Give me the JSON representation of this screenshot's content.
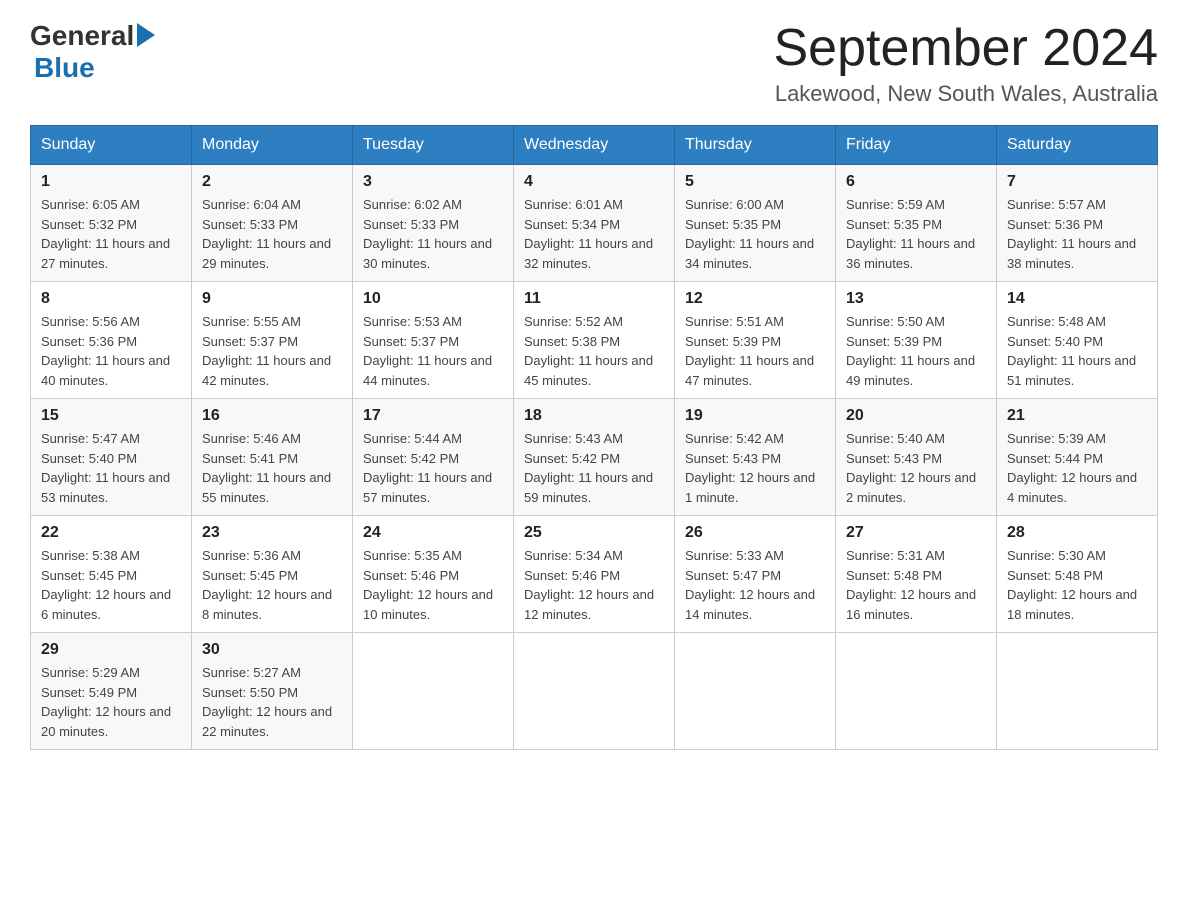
{
  "header": {
    "logo_general": "General",
    "logo_blue": "Blue",
    "title": "September 2024",
    "subtitle": "Lakewood, New South Wales, Australia"
  },
  "days_of_week": [
    "Sunday",
    "Monday",
    "Tuesday",
    "Wednesday",
    "Thursday",
    "Friday",
    "Saturday"
  ],
  "weeks": [
    [
      {
        "day": "1",
        "sunrise": "6:05 AM",
        "sunset": "5:32 PM",
        "daylight": "11 hours and 27 minutes."
      },
      {
        "day": "2",
        "sunrise": "6:04 AM",
        "sunset": "5:33 PM",
        "daylight": "11 hours and 29 minutes."
      },
      {
        "day": "3",
        "sunrise": "6:02 AM",
        "sunset": "5:33 PM",
        "daylight": "11 hours and 30 minutes."
      },
      {
        "day": "4",
        "sunrise": "6:01 AM",
        "sunset": "5:34 PM",
        "daylight": "11 hours and 32 minutes."
      },
      {
        "day": "5",
        "sunrise": "6:00 AM",
        "sunset": "5:35 PM",
        "daylight": "11 hours and 34 minutes."
      },
      {
        "day": "6",
        "sunrise": "5:59 AM",
        "sunset": "5:35 PM",
        "daylight": "11 hours and 36 minutes."
      },
      {
        "day": "7",
        "sunrise": "5:57 AM",
        "sunset": "5:36 PM",
        "daylight": "11 hours and 38 minutes."
      }
    ],
    [
      {
        "day": "8",
        "sunrise": "5:56 AM",
        "sunset": "5:36 PM",
        "daylight": "11 hours and 40 minutes."
      },
      {
        "day": "9",
        "sunrise": "5:55 AM",
        "sunset": "5:37 PM",
        "daylight": "11 hours and 42 minutes."
      },
      {
        "day": "10",
        "sunrise": "5:53 AM",
        "sunset": "5:37 PM",
        "daylight": "11 hours and 44 minutes."
      },
      {
        "day": "11",
        "sunrise": "5:52 AM",
        "sunset": "5:38 PM",
        "daylight": "11 hours and 45 minutes."
      },
      {
        "day": "12",
        "sunrise": "5:51 AM",
        "sunset": "5:39 PM",
        "daylight": "11 hours and 47 minutes."
      },
      {
        "day": "13",
        "sunrise": "5:50 AM",
        "sunset": "5:39 PM",
        "daylight": "11 hours and 49 minutes."
      },
      {
        "day": "14",
        "sunrise": "5:48 AM",
        "sunset": "5:40 PM",
        "daylight": "11 hours and 51 minutes."
      }
    ],
    [
      {
        "day": "15",
        "sunrise": "5:47 AM",
        "sunset": "5:40 PM",
        "daylight": "11 hours and 53 minutes."
      },
      {
        "day": "16",
        "sunrise": "5:46 AM",
        "sunset": "5:41 PM",
        "daylight": "11 hours and 55 minutes."
      },
      {
        "day": "17",
        "sunrise": "5:44 AM",
        "sunset": "5:42 PM",
        "daylight": "11 hours and 57 minutes."
      },
      {
        "day": "18",
        "sunrise": "5:43 AM",
        "sunset": "5:42 PM",
        "daylight": "11 hours and 59 minutes."
      },
      {
        "day": "19",
        "sunrise": "5:42 AM",
        "sunset": "5:43 PM",
        "daylight": "12 hours and 1 minute."
      },
      {
        "day": "20",
        "sunrise": "5:40 AM",
        "sunset": "5:43 PM",
        "daylight": "12 hours and 2 minutes."
      },
      {
        "day": "21",
        "sunrise": "5:39 AM",
        "sunset": "5:44 PM",
        "daylight": "12 hours and 4 minutes."
      }
    ],
    [
      {
        "day": "22",
        "sunrise": "5:38 AM",
        "sunset": "5:45 PM",
        "daylight": "12 hours and 6 minutes."
      },
      {
        "day": "23",
        "sunrise": "5:36 AM",
        "sunset": "5:45 PM",
        "daylight": "12 hours and 8 minutes."
      },
      {
        "day": "24",
        "sunrise": "5:35 AM",
        "sunset": "5:46 PM",
        "daylight": "12 hours and 10 minutes."
      },
      {
        "day": "25",
        "sunrise": "5:34 AM",
        "sunset": "5:46 PM",
        "daylight": "12 hours and 12 minutes."
      },
      {
        "day": "26",
        "sunrise": "5:33 AM",
        "sunset": "5:47 PM",
        "daylight": "12 hours and 14 minutes."
      },
      {
        "day": "27",
        "sunrise": "5:31 AM",
        "sunset": "5:48 PM",
        "daylight": "12 hours and 16 minutes."
      },
      {
        "day": "28",
        "sunrise": "5:30 AM",
        "sunset": "5:48 PM",
        "daylight": "12 hours and 18 minutes."
      }
    ],
    [
      {
        "day": "29",
        "sunrise": "5:29 AM",
        "sunset": "5:49 PM",
        "daylight": "12 hours and 20 minutes."
      },
      {
        "day": "30",
        "sunrise": "5:27 AM",
        "sunset": "5:50 PM",
        "daylight": "12 hours and 22 minutes."
      },
      null,
      null,
      null,
      null,
      null
    ]
  ],
  "labels": {
    "sunrise": "Sunrise:",
    "sunset": "Sunset:",
    "daylight": "Daylight:"
  }
}
